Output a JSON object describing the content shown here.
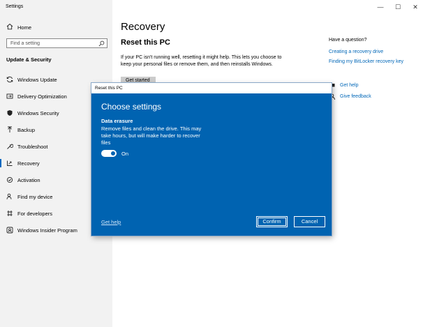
{
  "window": {
    "title": "Settings",
    "controls": {
      "minimize": "—",
      "maximize": "☐",
      "close": "✕"
    }
  },
  "sidebar": {
    "home": "Home",
    "search_placeholder": "Find a setting",
    "section": "Update & Security",
    "items": [
      {
        "label": "Windows Update",
        "icon": "sync-icon"
      },
      {
        "label": "Delivery Optimization",
        "icon": "delivery-optimization-icon"
      },
      {
        "label": "Windows Security",
        "icon": "shield-icon"
      },
      {
        "label": "Backup",
        "icon": "backup-icon"
      },
      {
        "label": "Troubleshoot",
        "icon": "wrench-icon"
      },
      {
        "label": "Recovery",
        "icon": "recovery-icon",
        "active": true
      },
      {
        "label": "Activation",
        "icon": "activation-icon"
      },
      {
        "label": "Find my device",
        "icon": "person-location-icon"
      },
      {
        "label": "For developers",
        "icon": "developer-icon"
      },
      {
        "label": "Windows Insider Program",
        "icon": "insider-icon"
      }
    ]
  },
  "main": {
    "title": "Recovery",
    "section_title": "Reset this PC",
    "description": "If your PC isn't running well, resetting it might help. This lets you choose to keep your personal files or remove them, and then reinstalls Windows.",
    "get_started": "Get started",
    "question": "Have a question?",
    "links": [
      "Creating a recovery drive",
      "Finding my BitLocker recovery key"
    ],
    "get_help": "Get help",
    "give_feedback": "Give feedback"
  },
  "dialog": {
    "title": "Reset this PC",
    "heading": "Choose settings",
    "label": "Data erasure",
    "description": "Remove files and clean the drive. This may take hours, but will make harder to recover files",
    "toggle_state": "On",
    "toggle_on": true,
    "help_link": "Get help",
    "confirm": "Confirm",
    "cancel": "Cancel"
  },
  "colors": {
    "accent": "#0063b1",
    "link": "#0067b8",
    "sidebar_bg": "#f2f2f2"
  }
}
